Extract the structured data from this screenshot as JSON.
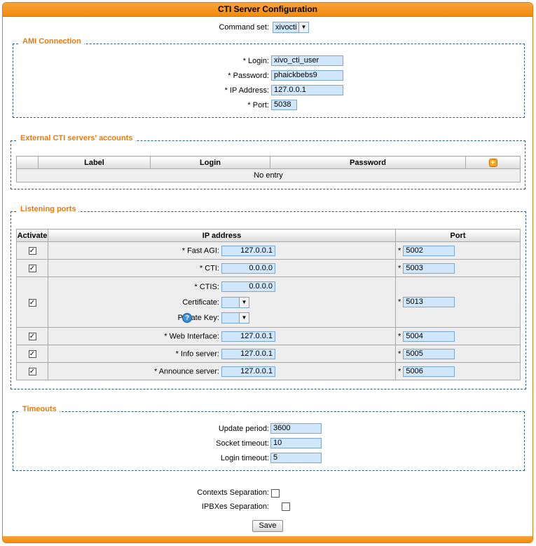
{
  "title": "CTI Server Configuration",
  "command_set": {
    "label": "Command set:",
    "value": "xivocti"
  },
  "ami": {
    "legend": "AMI Connection",
    "login_label": "* Login:",
    "login": "xivo_cti_user",
    "password_label": "* Password:",
    "password": "phaickbebs9",
    "ip_label": "* IP Address:",
    "ip": "127.0.0.1",
    "port_label": "* Port:",
    "port": "5038"
  },
  "external": {
    "legend": "External CTI servers' accounts",
    "columns": [
      "Label",
      "Login",
      "Password"
    ],
    "empty": "No entry",
    "add_icon": "add-icon"
  },
  "listening": {
    "legend": "Listening ports",
    "columns": {
      "activate": "Activate",
      "ip": "IP address",
      "port": "Port"
    },
    "rows": [
      {
        "label": "* Fast AGI:",
        "ip": "127.0.0.1",
        "port": "5002",
        "checked": true
      },
      {
        "label": "* CTI:",
        "ip": "0.0.0.0",
        "port": "5003",
        "checked": true
      },
      {
        "label": "* CTIS:",
        "ip": "0.0.0.0",
        "port": "5013",
        "checked": true,
        "certificate_label": "Certificate:",
        "private_key_label": "Private Key:"
      },
      {
        "label": "* Web Interface:",
        "ip": "127.0.0.1",
        "port": "5004",
        "checked": true
      },
      {
        "label": "* Info server:",
        "ip": "127.0.0.1",
        "port": "5005",
        "checked": true
      },
      {
        "label": "* Announce server:",
        "ip": "127.0.0.1",
        "port": "5006",
        "checked": true
      }
    ],
    "port_star": "*"
  },
  "timeouts": {
    "legend": "Timeouts",
    "update_label": "Update period:",
    "update": "3600",
    "socket_label": "Socket timeout:",
    "socket": "10",
    "login_label": "Login timeout:",
    "login": "5"
  },
  "contexts_label": "Contexts Separation:",
  "ipbx_label": "IPBXes Separation:",
  "save_label": "Save",
  "colors": {
    "accent": "#f28a0c",
    "input_bg": "#cfe6fb",
    "legend": "#e87a10"
  }
}
